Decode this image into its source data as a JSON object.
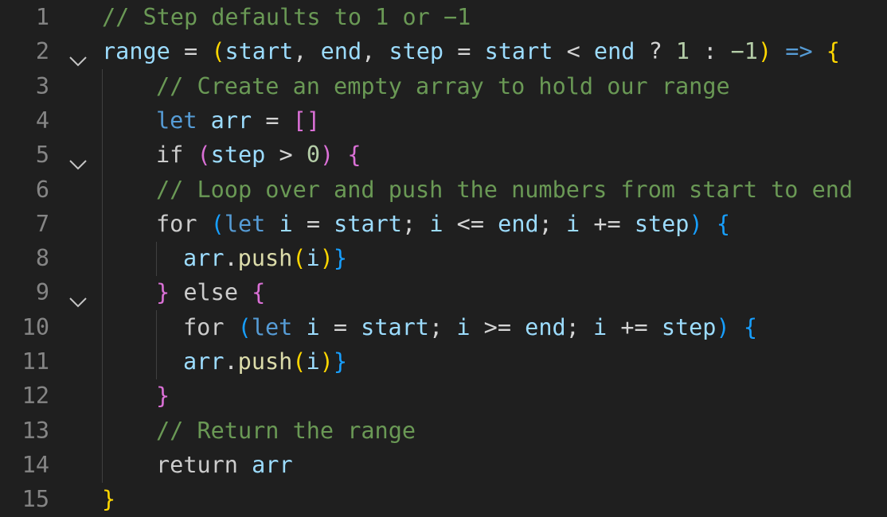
{
  "editor": {
    "lines": [
      {
        "number": "1",
        "fold": false,
        "text": "// Step defaults to 1 or −1"
      },
      {
        "number": "2",
        "fold": true,
        "text": "range = (start, end, step = start < end ? 1 : −1) => {"
      },
      {
        "number": "3",
        "fold": false,
        "text": "// Create an empty array to hold our range"
      },
      {
        "number": "4",
        "fold": false,
        "text": "let arr = []"
      },
      {
        "number": "5",
        "fold": true,
        "text": "if (step > 0) {"
      },
      {
        "number": "6",
        "fold": false,
        "text": "// Loop over and push the numbers from start to end"
      },
      {
        "number": "7",
        "fold": false,
        "text": "for (let i = start; i <= end; i += step) {"
      },
      {
        "number": "8",
        "fold": false,
        "text": "arr.push(i)}"
      },
      {
        "number": "9",
        "fold": true,
        "text": "} else {"
      },
      {
        "number": "10",
        "fold": false,
        "text": "for (let i = start; i >= end; i += step) {"
      },
      {
        "number": "11",
        "fold": false,
        "text": "arr.push(i)}"
      },
      {
        "number": "12",
        "fold": false,
        "text": "}"
      },
      {
        "number": "13",
        "fold": false,
        "text": "// Return the range"
      },
      {
        "number": "14",
        "fold": false,
        "text": "return arr"
      },
      {
        "number": "15",
        "fold": false,
        "text": "}"
      }
    ]
  },
  "icons": {
    "fold": "chevron-down-icon"
  },
  "colors": {
    "background": "#1f1f1f",
    "line_number": "#858585",
    "comment": "#6a9955",
    "keyword": "#569cd6",
    "variable": "#9cdcfe",
    "function": "#dcdcaa",
    "number": "#b5cea8",
    "bracket_level_1": "#ffd700",
    "bracket_level_2": "#da70d6"
  }
}
